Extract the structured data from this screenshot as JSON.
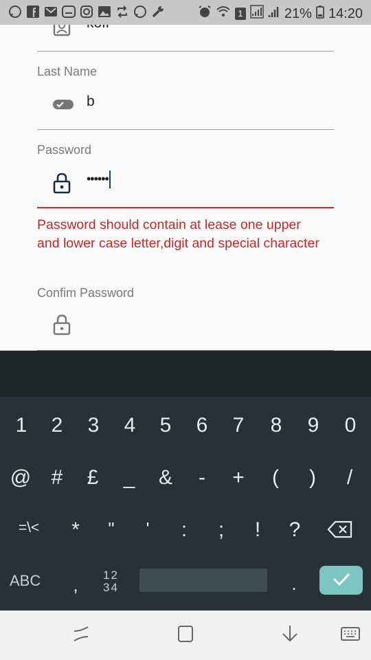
{
  "status_bar": {
    "left_icons": [
      "whatsapp-icon",
      "facebook-icon",
      "gmail-icon",
      "messenger-icon",
      "instagram-icon",
      "gallery-icon",
      "sync-icon",
      "whatsapp-icon",
      "wrench-icon"
    ],
    "sim_badge": "1",
    "battery_percent": "21%",
    "time": "14:20"
  },
  "form": {
    "first_name": {
      "value": "kofi",
      "icon": "contact-icon"
    },
    "last_name": {
      "label": "Last Name",
      "value": "b",
      "icon": "toggle-icon"
    },
    "password": {
      "label": "Password",
      "value": "••••••",
      "icon": "lock-icon",
      "error": "Password should contain at lease one upper and lower case letter,digit and special character"
    },
    "confirm_password": {
      "label": "Confim Password",
      "value": "",
      "icon": "lock-icon"
    },
    "colors": {
      "error": "#d32f2f",
      "label": "#7a7a7a",
      "lock_active": "#1a2a4a"
    }
  },
  "keyboard": {
    "row1": [
      "1",
      "2",
      "3",
      "4",
      "5",
      "6",
      "7",
      "8",
      "9",
      "0"
    ],
    "row2": [
      "@",
      "#",
      "£",
      "_",
      "&",
      "-",
      "+",
      "(",
      ")",
      "/"
    ],
    "row3": [
      "=\\<",
      "*",
      "\"",
      "'",
      ":",
      ";",
      "!",
      "?"
    ],
    "abc_label": "ABC",
    "comma": ",",
    "numpad_top": "12",
    "numpad_bottom": "34",
    "period": ".",
    "colors": {
      "background": "#263238",
      "enter": "#7cc5c0"
    }
  },
  "nav_bar": {
    "buttons": [
      "recents-icon",
      "home-icon",
      "back-icon",
      "keyboard-icon"
    ]
  }
}
